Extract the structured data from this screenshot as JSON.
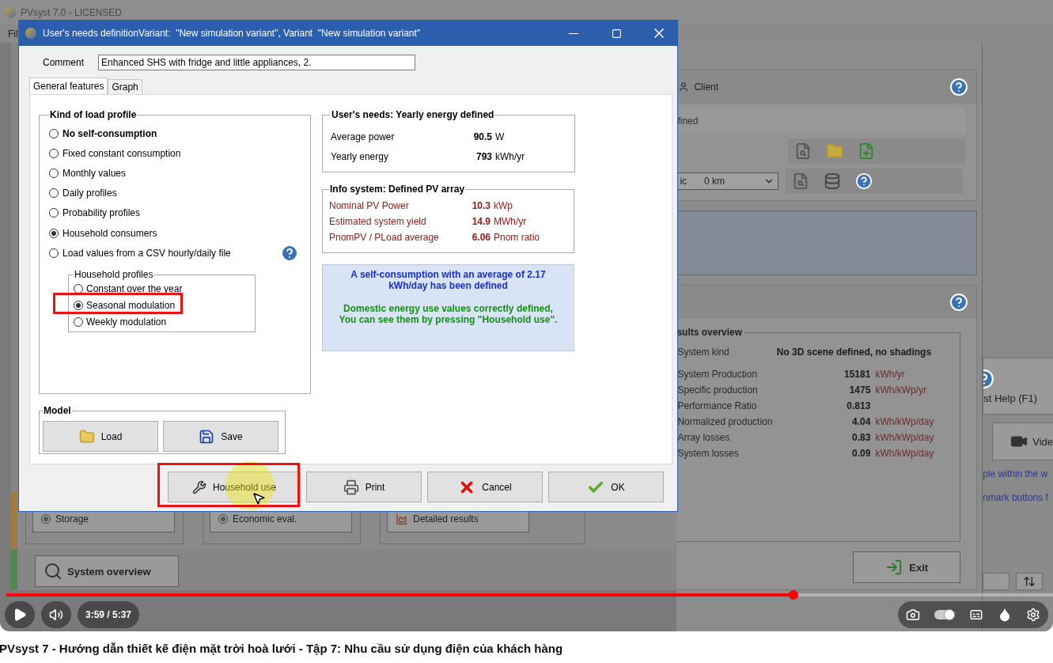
{
  "video_frame": {
    "app": {
      "title": "PVsyst 7.0 - LICENSED",
      "menu": [
        "Fil"
      ],
      "client_section": {
        "label": "Client",
        "status": "fined",
        "combo_prefix": "ic",
        "combo_value": "0 km"
      },
      "results_overview": {
        "title": "sults overview",
        "system_kind_label": "System kind",
        "system_kind": "No 3D scene defined, no shadings",
        "rows": [
          {
            "label": "System Production",
            "value": "15181",
            "unit": "kWh/yr"
          },
          {
            "label": "Specific production",
            "value": "1475",
            "unit": "kWh/kWp/yr"
          },
          {
            "label": "Performance Ratio",
            "value": "0.813"
          },
          {
            "label": "Normalized production",
            "value": "4.04",
            "unit": "kWh/kWp/day"
          },
          {
            "label": "Array losses",
            "value": "0.83",
            "unit": "kWh/kWp/day"
          },
          {
            "label": "System losses",
            "value": "0.09",
            "unit": "kWh/kWp/day"
          }
        ]
      },
      "help_panel": {
        "quick_help": "st Help (F1)",
        "video": "Vide",
        "lines": [
          "ple within the w",
          "nmark buttons f"
        ]
      },
      "simulation_buttons": [
        {
          "label": "Storage",
          "kind": "led"
        },
        {
          "label": "Economic eval.",
          "kind": "led"
        },
        {
          "label": "Detailed results",
          "kind": "chart"
        }
      ],
      "system_overview": "System overview",
      "exit": "Exit"
    },
    "dialog": {
      "title": "User's needs definitionVariant:  \"New simulation variant\", Variant  \"New simulation variant\"",
      "comment_label": "Comment",
      "comment": "Enhanced SHS with fridge and little appliances, 2.",
      "tabs": [
        {
          "label": "General features",
          "selected": true
        },
        {
          "label": "Graph",
          "selected": false
        }
      ],
      "load_profile": {
        "title": "Kind of load profile",
        "options": [
          {
            "label": "No self-consumption",
            "selected": false,
            "bold": true
          },
          {
            "label": "Fixed constant consumption",
            "selected": false,
            "bold": false
          },
          {
            "label": "Monthly values",
            "selected": false,
            "bold": false
          },
          {
            "label": "Daily profiles",
            "selected": false,
            "bold": false
          },
          {
            "label": "Probability profiles",
            "selected": false,
            "bold": false
          },
          {
            "label": "Household consumers",
            "selected": true,
            "bold": false
          },
          {
            "label": "Load values from a CSV hourly/daily file",
            "selected": false,
            "bold": false
          }
        ],
        "household_profiles": {
          "title": "Household profiles",
          "options": [
            {
              "label": "Constant over the year",
              "selected": false
            },
            {
              "label": "Seasonal modulation",
              "selected": true
            },
            {
              "label": "Weekly modulation",
              "selected": false
            }
          ]
        }
      },
      "needs": {
        "title": "User's needs: Yearly energy defined",
        "rows": [
          {
            "label": "Average power",
            "value": "90.5",
            "unit": "W"
          },
          {
            "label": "Yearly energy",
            "value": "793",
            "unit": "kWh/yr"
          }
        ]
      },
      "pv_info": {
        "title": "Info system: Defined PV array",
        "rows": [
          {
            "label": "Nominal PV Power",
            "value": "10.3",
            "unit": "kWp"
          },
          {
            "label": "Estimated system yield",
            "value": "14.9",
            "unit": "MWh/yr"
          },
          {
            "label": "PnomPV / PLoad average",
            "value": "6.06",
            "unit": "Pnom ratio"
          }
        ]
      },
      "message": {
        "summary": "A self-consumption with an average of 2.17 kWh/day has been defined",
        "status": "Domestic energy use values correctly defined, You can see them by pressing \"Household use\"."
      },
      "model": {
        "title": "Model",
        "buttons": [
          {
            "label": "Load",
            "kind": "load"
          },
          {
            "label": "Save",
            "kind": "save"
          }
        ]
      },
      "buttons": [
        {
          "label": "Household use",
          "kind": "household"
        },
        {
          "label": "Print",
          "kind": "print"
        },
        {
          "label": "Cancel",
          "kind": "cancel"
        },
        {
          "label": "OK",
          "kind": "ok"
        }
      ]
    },
    "player": {
      "level": 0.752,
      "time": "3:59 / 5:37",
      "autoplay_on": true
    }
  },
  "video_title": "PVsyst 7 - Hướng dẫn thiết kế điện mặt trời hoà lưới - Tập 7: Nhu cầu sử dụng điện của khách hàng"
}
